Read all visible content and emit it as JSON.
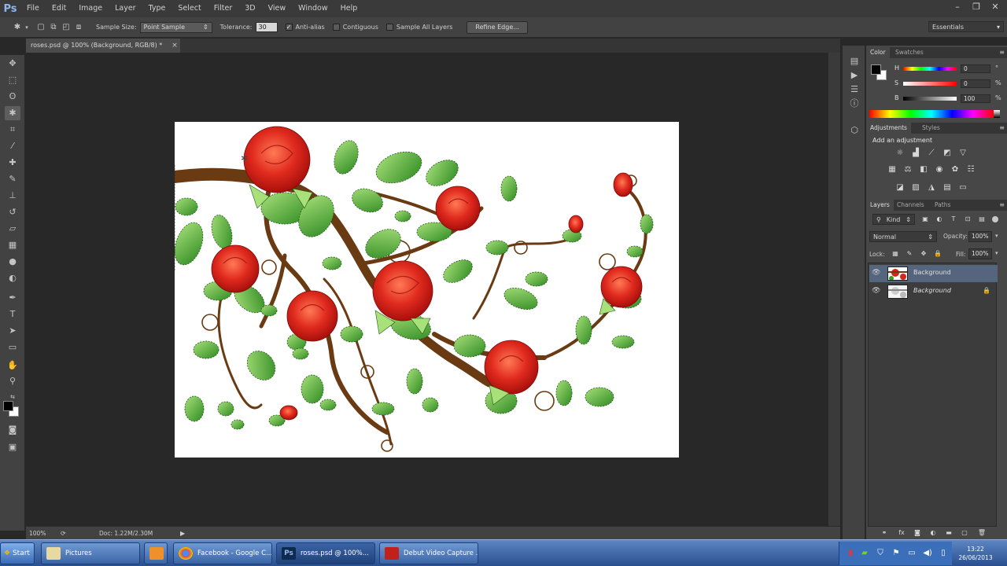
{
  "app": {
    "logo": "Ps"
  },
  "menu": [
    "File",
    "Edit",
    "Image",
    "Layer",
    "Type",
    "Select",
    "Filter",
    "3D",
    "View",
    "Window",
    "Help"
  ],
  "window_controls": {
    "minimize": "–",
    "restore": "❐",
    "close": "✕"
  },
  "options_bar": {
    "sample_size_label": "Sample Size:",
    "sample_size_value": "Point Sample",
    "tolerance_label": "Tolerance:",
    "tolerance_value": "30",
    "anti_alias_label": "Anti-alias",
    "contiguous_label": "Contiguous",
    "sample_all_layers_label": "Sample All Layers",
    "refine_edge_label": "Refine Edge...",
    "workspace_value": "Essentials"
  },
  "document": {
    "tab_title": "roses.psd @ 100% (Background, RGB/8) *",
    "close_label": "×"
  },
  "status": {
    "zoom": "100%",
    "doc_info": "Doc: 1.22M/2.30M"
  },
  "color_panel": {
    "tabs": [
      "Color",
      "Swatches"
    ],
    "h_label": "H",
    "h_value": "0",
    "h_unit": "°",
    "s_label": "S",
    "s_value": "0",
    "s_unit": "%",
    "b_label": "B",
    "b_value": "100",
    "b_unit": "%"
  },
  "adjustments_panel": {
    "tabs": [
      "Adjustments",
      "Styles"
    ],
    "heading": "Add an adjustment"
  },
  "layers_panel": {
    "tabs": [
      "Layers",
      "Channels",
      "Paths"
    ],
    "kind_filter": "Kind",
    "blend_mode": "Normal",
    "opacity_label": "Opacity:",
    "opacity_value": "100%",
    "lock_label": "Lock:",
    "fill_label": "Fill:",
    "fill_value": "100%",
    "layers": [
      {
        "name": "Background",
        "selected": true
      },
      {
        "name": "Background",
        "selected": false,
        "locked": true
      }
    ]
  },
  "taskbar": {
    "start_label": "Start",
    "tasks": [
      {
        "label": "Pictures"
      },
      {
        "label": ""
      },
      {
        "label": "Facebook - Google C..."
      },
      {
        "label": "roses.psd @ 100%..."
      },
      {
        "label": "Debut Video Capture ..."
      }
    ],
    "clock_time": "13:22",
    "clock_date": "26/06/2013"
  },
  "colors": {
    "accent": "#4f6d95",
    "rose": "#d8241b",
    "leaf": "#3d9a2a",
    "stem": "#6a3a12"
  }
}
